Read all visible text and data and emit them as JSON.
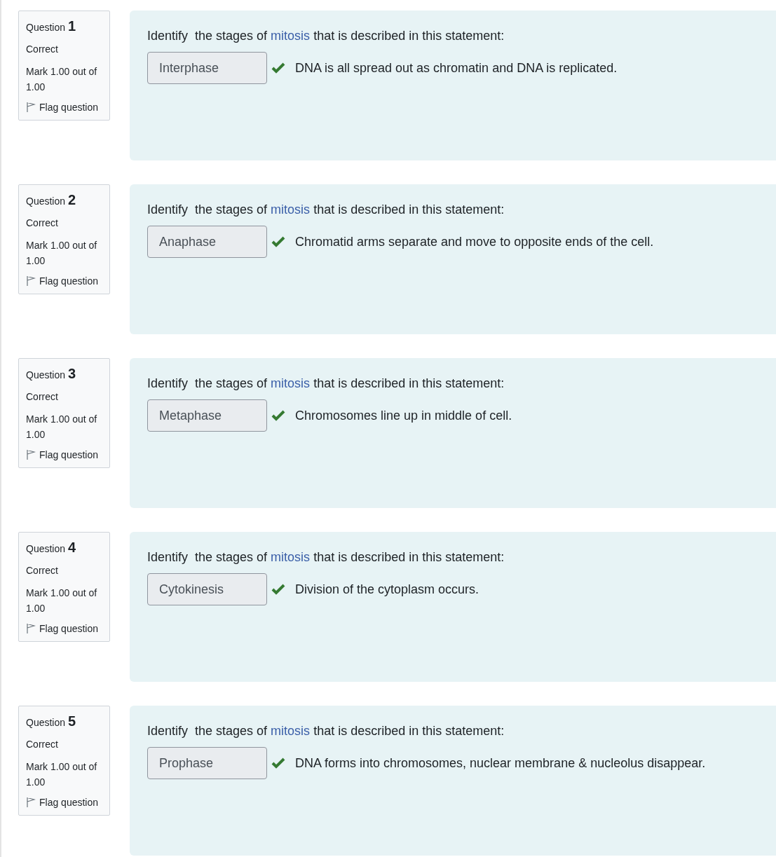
{
  "questions": [
    {
      "label": "Question",
      "number": "1",
      "status": "Correct",
      "mark": "Mark 1.00 out of 1.00",
      "flag": "Flag question",
      "flagged": false,
      "prompt_before": "Identify  the stages of ",
      "prompt_link": "mitosis",
      "prompt_after": " that is described in this statement:",
      "answer": "Interphase",
      "correct": true,
      "statement": "DNA is all spread out as chromatin and DNA is replicated."
    },
    {
      "label": "Question",
      "number": "2",
      "status": "Correct",
      "mark": "Mark 1.00 out of 1.00",
      "flag": "Flag question",
      "flagged": false,
      "prompt_before": "Identify  the stages of ",
      "prompt_link": "mitosis",
      "prompt_after": " that is described in this statement:",
      "answer": "Anaphase",
      "correct": true,
      "statement": "Chromatid arms separate and move to opposite ends of the cell."
    },
    {
      "label": "Question",
      "number": "3",
      "status": "Correct",
      "mark": "Mark 1.00 out of 1.00",
      "flag": "Flag question",
      "flagged": false,
      "prompt_before": "Identify  the stages of ",
      "prompt_link": "mitosis",
      "prompt_after": " that is described in this statement:",
      "answer": "Metaphase",
      "correct": true,
      "statement": "Chromosomes line up in middle of cell."
    },
    {
      "label": "Question",
      "number": "4",
      "status": "Correct",
      "mark": "Mark 1.00 out of 1.00",
      "flag": "Flag question",
      "flagged": false,
      "prompt_before": "Identify  the stages of ",
      "prompt_link": "mitosis",
      "prompt_after": " that is described in this statement:",
      "answer": "Cytokinesis",
      "correct": true,
      "statement": "Division of the cytoplasm occurs."
    },
    {
      "label": "Question",
      "number": "5",
      "status": "Correct",
      "mark": "Mark 1.00 out of 1.00",
      "flag": "Flag question",
      "flagged": false,
      "prompt_before": "Identify  the stages of ",
      "prompt_link": "mitosis",
      "prompt_after": " that is described in this statement:",
      "answer": "Prophase",
      "correct": true,
      "statement": "DNA forms into chromosomes, nuclear membrane & nucleolus disappear."
    }
  ]
}
